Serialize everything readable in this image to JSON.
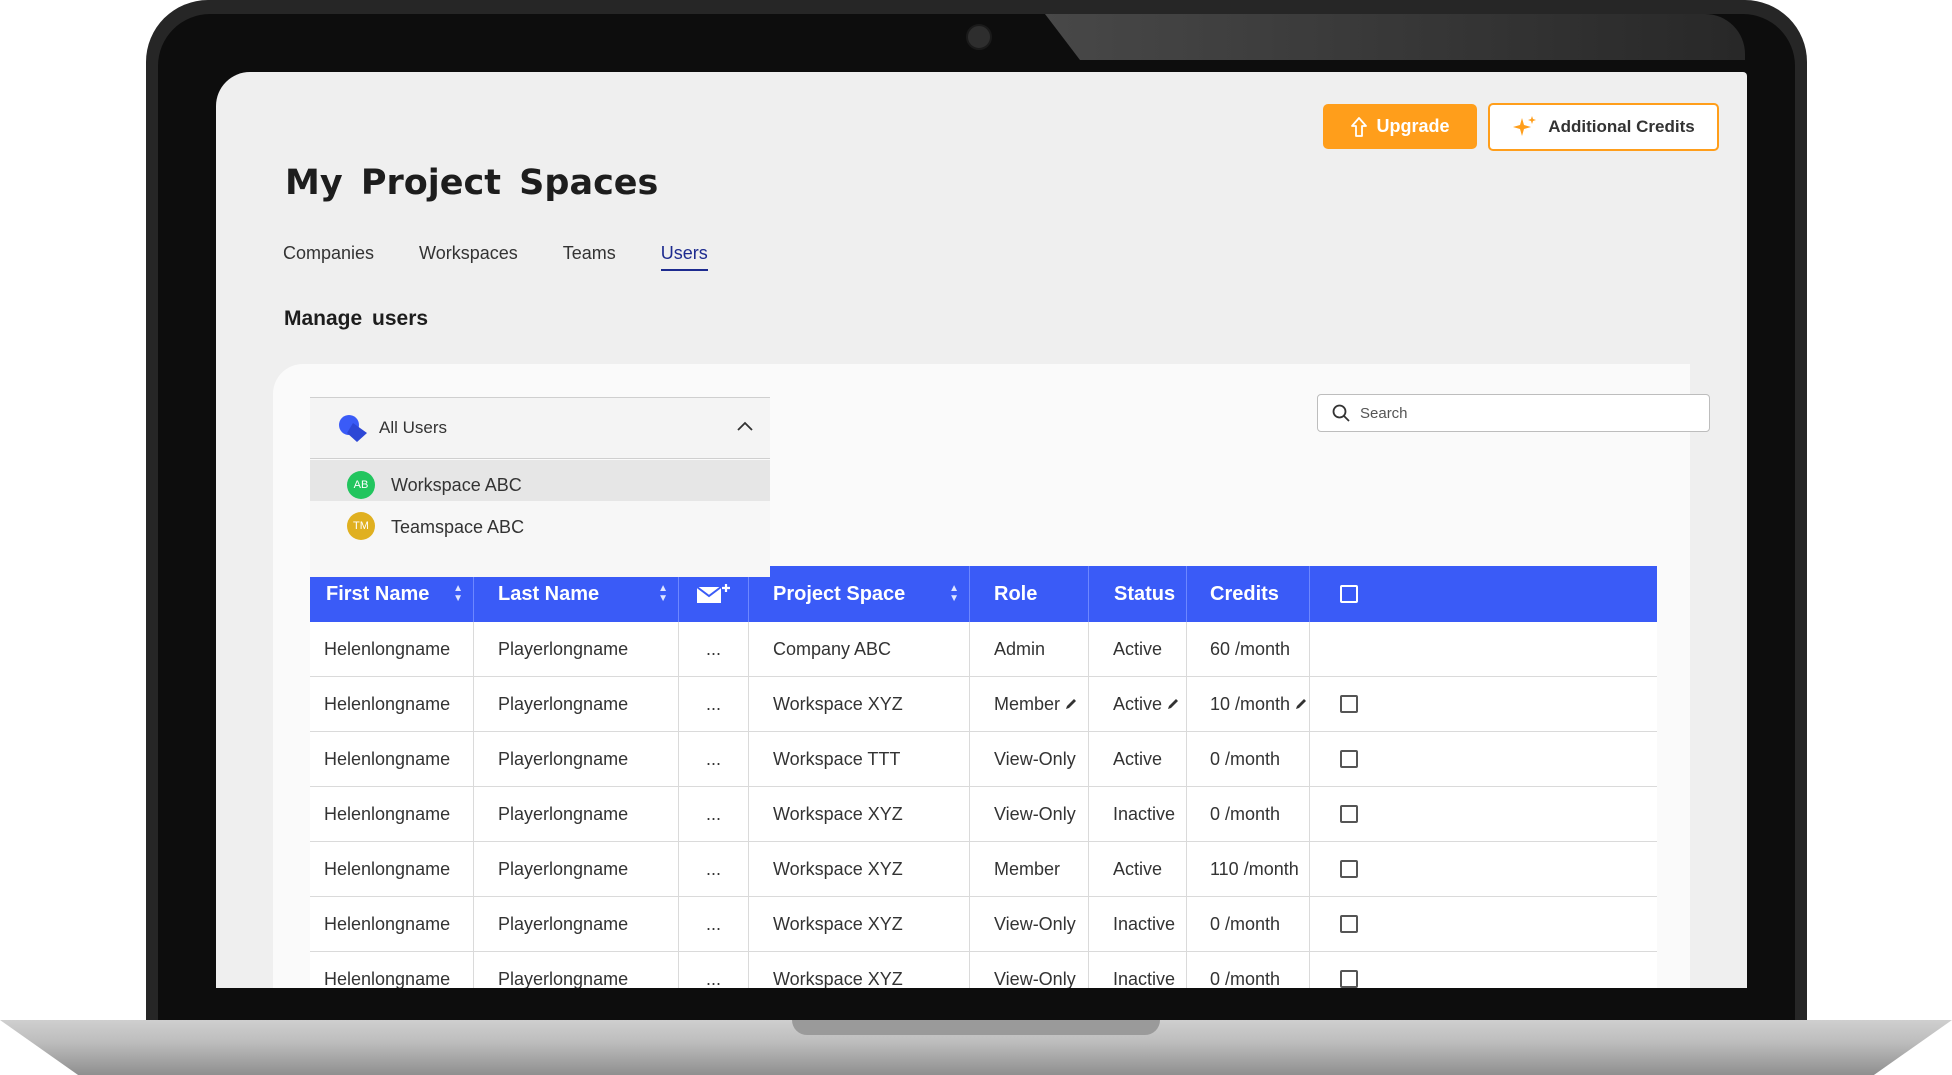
{
  "header": {
    "upgrade_label": "Upgrade",
    "credits_label": "Additional Credits"
  },
  "page": {
    "title": "My  Project  Spaces",
    "section_title": "Manage  users"
  },
  "tabs": [
    {
      "label": "Companies"
    },
    {
      "label": "Workspaces"
    },
    {
      "label": "Teams"
    },
    {
      "label": "Users",
      "active": true
    }
  ],
  "dropdown": {
    "selected": "All Users",
    "options": [
      {
        "label": "Workspace ABC",
        "initials": "AB",
        "color": "#22c55e"
      },
      {
        "label": "Teamspace ABC",
        "initials": "TM",
        "color": "#e0b020"
      }
    ]
  },
  "search": {
    "placeholder": "Search"
  },
  "table": {
    "columns": [
      "First Name",
      "Last Name",
      "",
      "Project Space",
      "Role",
      "Status",
      "Credits",
      ""
    ],
    "rows": [
      {
        "first": "Helenlongname",
        "last": "Playerlongname",
        "more": "...",
        "space": "Company ABC",
        "role": "Admin",
        "status": "Active",
        "credits": "60 /month"
      },
      {
        "first": "Helenlongname",
        "last": "Playerlongname",
        "more": "...",
        "space": "Workspace XYZ",
        "role": "Member",
        "status": "Active",
        "credits": "10 /month"
      },
      {
        "first": "Helenlongname",
        "last": "Playerlongname",
        "more": "...",
        "space": "Workspace TTT",
        "role": "View-Only",
        "status": "Active",
        "credits": "0 /month"
      },
      {
        "first": "Helenlongname",
        "last": "Playerlongname",
        "more": "...",
        "space": "Workspace XYZ",
        "role": "View-Only",
        "status": "Inactive",
        "credits": "0 /month"
      },
      {
        "first": "Helenlongname",
        "last": "Playerlongname",
        "more": "...",
        "space": "Workspace XYZ",
        "role": "Member",
        "status": "Active",
        "credits": "110 /month"
      },
      {
        "first": "Helenlongname",
        "last": "Playerlongname",
        "more": "...",
        "space": "Workspace XYZ",
        "role": "View-Only",
        "status": "Inactive",
        "credits": "0 /month"
      },
      {
        "first": "Helenlongname",
        "last": "Playerlongname",
        "more": "...",
        "space": "Workspace XYZ",
        "role": "View-Only",
        "status": "Inactive",
        "credits": "0 /month"
      }
    ]
  },
  "colors": {
    "accent": "#3a5bf7",
    "upgrade": "#ff9e1b",
    "tab_active": "#1d2b8f"
  }
}
